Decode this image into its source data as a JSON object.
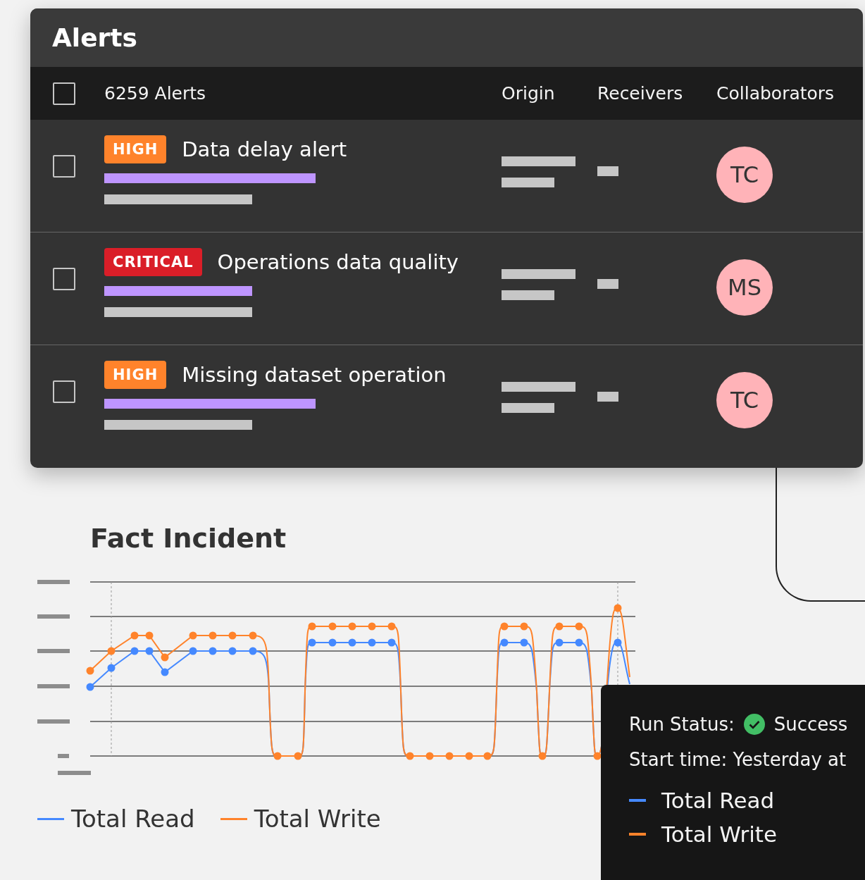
{
  "alerts": {
    "title": "Alerts",
    "header": {
      "checked": false,
      "count": "6259 Alerts",
      "columns": [
        "Origin",
        "Receivers",
        "Collaborators"
      ]
    },
    "rows": [
      {
        "checked": false,
        "severity": "HIGH",
        "kind": "high",
        "title": "Data delay alert",
        "avatar": "TC"
      },
      {
        "checked": false,
        "severity": "CRITICAL",
        "kind": "critical",
        "title": "Operations data quality",
        "avatar": "MS"
      },
      {
        "checked": false,
        "severity": "HIGH",
        "kind": "high",
        "title": "Missing dataset operation",
        "avatar": "TC"
      }
    ]
  },
  "chart": {
    "title": "Fact Incident",
    "legend": [
      {
        "label": "Total Read",
        "color": "#4589ff"
      },
      {
        "label": "Total Write",
        "color": "#ff832b"
      }
    ]
  },
  "tooltip": {
    "status_label": "Run Status:",
    "status": "Success",
    "start_time": "Start time: Yesterday at",
    "legend": [
      {
        "label": "Total Read",
        "color": "#4589ff"
      },
      {
        "label": "Total Write",
        "color": "#ff832b"
      }
    ]
  }
}
